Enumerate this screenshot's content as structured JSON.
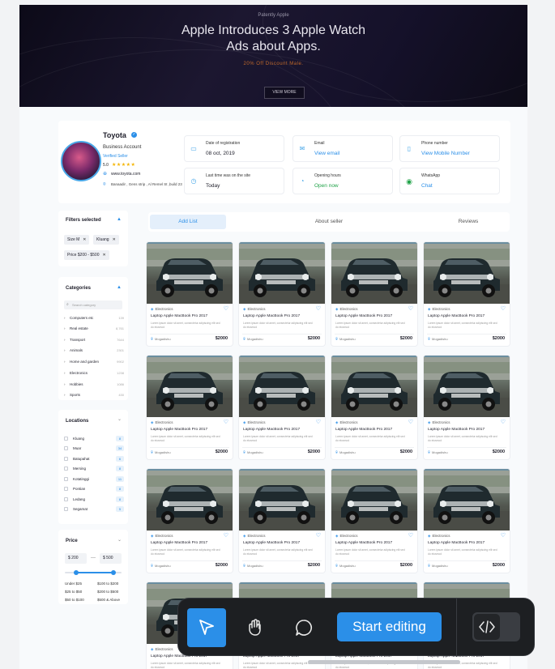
{
  "banner": {
    "kicker": "Patently Apple",
    "title_line1": "Apple Introduces 3 Apple Watch",
    "title_line2": "Ads about Apps.",
    "subtitle": "20% Off Discount Male.",
    "button": "VIEW MORE"
  },
  "seller": {
    "name": "Toyota",
    "account_type": "Business Account",
    "verified_label": "Verified Seller",
    "rating": "5.0",
    "stars": "★★★★★",
    "website": "www.toyota.com",
    "address": "Banaadir , Gens strip , Al Remel St ,build 23",
    "info": [
      {
        "icon": "calendar-icon",
        "glyph": "▭",
        "label": "Date of registration",
        "value": "08 oct, 2019",
        "style": ""
      },
      {
        "icon": "email-icon",
        "glyph": "✉",
        "label": "Email",
        "value": "View email",
        "style": "link"
      },
      {
        "icon": "phone-icon",
        "glyph": "▯",
        "label": "Phone number",
        "value": "View Mobile Number",
        "style": "link"
      },
      {
        "icon": "clock-icon",
        "glyph": "◷",
        "label": "Last time was on the site",
        "value": "Today",
        "style": ""
      },
      {
        "icon": "hours-icon",
        "glyph": "◔",
        "label": "Opening hours",
        "value": "Open now",
        "style": "green"
      },
      {
        "icon": "whatsapp-icon",
        "glyph": "◉",
        "label": "WhatsApp",
        "value": "Chat",
        "style": "link"
      }
    ]
  },
  "filters": {
    "title": "Filters selected",
    "chips": [
      "Size M",
      "Kluang",
      "Price $200 - $500"
    ]
  },
  "categories": {
    "title": "Categories",
    "search_placeholder": "Search category",
    "items": [
      {
        "label": "Computers etc",
        "count": "139"
      },
      {
        "label": "Real estate",
        "count": "8,761"
      },
      {
        "label": "Transport",
        "count": "7644"
      },
      {
        "label": "Animals",
        "count": "2301"
      },
      {
        "label": "Home and garden",
        "count": "9902"
      },
      {
        "label": "Electronics",
        "count": "1238"
      },
      {
        "label": "Hobbies",
        "count": "1086"
      },
      {
        "label": "Sports",
        "count": "430"
      }
    ]
  },
  "locations": {
    "title": "Locations",
    "items": [
      {
        "label": "Kluang",
        "count": "8"
      },
      {
        "label": "Muar",
        "count": "34"
      },
      {
        "label": "Batupahat",
        "count": "6"
      },
      {
        "label": "Mersing",
        "count": "8"
      },
      {
        "label": "Kotatinggi",
        "count": "11"
      },
      {
        "label": "Pontian",
        "count": "8"
      },
      {
        "label": "Ledang",
        "count": "8"
      },
      {
        "label": "Segamat",
        "count": "5"
      }
    ]
  },
  "price": {
    "title": "Price",
    "min": "$ 200",
    "max": "$ 500",
    "dash": "—",
    "range_low": 0.2,
    "range_high": 0.85,
    "ranges": [
      "Under $25",
      "$100 to $200",
      "$25 to $50",
      "$200 to $500",
      "$50 to $100",
      "$500 & Above"
    ]
  },
  "tabs": [
    "Add List",
    "About seller",
    "Reviews"
  ],
  "listing": {
    "category": "Electronics",
    "title": "Laptop Apple MacBook Pro 2017",
    "description": "Lorem ipsum dolor sit amet, consectetur adipiscing elit sed do eiusmod",
    "location": "Mogadishu",
    "price": "$2000"
  },
  "toolbar": {
    "start_label": "Start editing"
  }
}
